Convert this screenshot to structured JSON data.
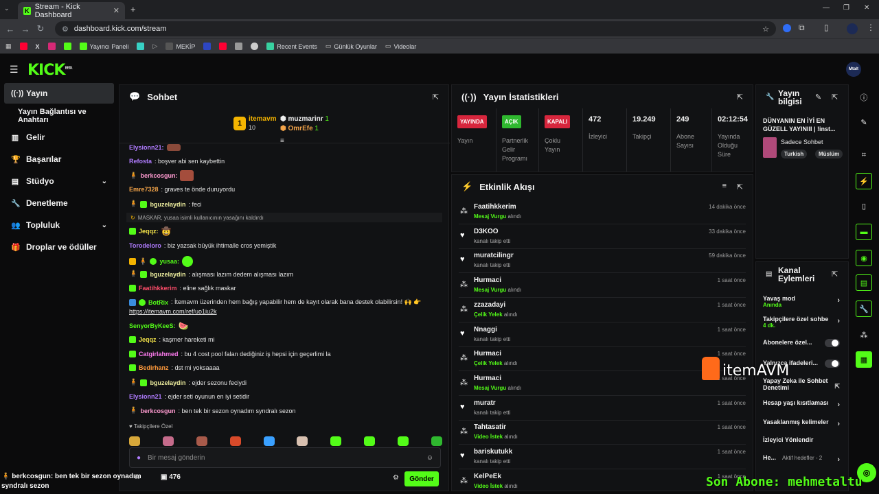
{
  "browser": {
    "tab_title": "Stream - Kick Dashboard",
    "url": "dashboard.kick.com/stream",
    "bookmarks": [
      "Yayıncı Paneli",
      "MEKİP",
      "Recent Events",
      "Günlük Oyunlar",
      "Videolar"
    ]
  },
  "kick": {
    "logo": "KICK",
    "logo_sup": "BETA",
    "avatar_text": "Mtalt"
  },
  "leftnav": {
    "items": [
      "Yayın",
      "Yayın Bağlantısı ve Anahtarı",
      "Gelir",
      "Başarılar",
      "Stüdyo",
      "Denetleme",
      "Topluluk",
      "Droplar ve ödüller"
    ]
  },
  "chat": {
    "title": "Sohbet",
    "leaders": [
      {
        "name": "itemavm",
        "count": "10",
        "rank": "1"
      },
      {
        "name": "muzmarinr",
        "count": "1"
      },
      {
        "name": "OmrEfe",
        "count": "1"
      }
    ],
    "messages": [
      {
        "user": "Elysionn21:",
        "text": "",
        "color": "#b07cff"
      },
      {
        "user": "Refosta",
        "text": ": boşver abi sen kaybettin",
        "color": "#b07cff"
      },
      {
        "user": "berkcosgun:",
        "text": "",
        "color": "#ff9bd1"
      },
      {
        "user": "Emre7328",
        "text": ": graves te önde duruyordu",
        "color": "#f2a349"
      },
      {
        "user": "bguzelaydin",
        "text": ": feci",
        "color": "#f0f0a0"
      },
      {
        "user": "Jeqqz:",
        "text": "",
        "color": "#f6e64a"
      },
      {
        "user": "Torodeloro",
        "text": ": biz yazsak büyük ihtimalle cros yemiştik",
        "color": "#b07cff"
      },
      {
        "user": "yusaa:",
        "text": "",
        "color": "#53fc18"
      },
      {
        "user": "bguzelaydin",
        "text": ": alışması lazım dedem alışması lazım",
        "color": "#f0f0a0"
      },
      {
        "user": "Faatihkkerim",
        "text": ": eline sağlık maskar",
        "color": "#ff4d6a"
      },
      {
        "user": "BotRix",
        "text": ": İtemavm üzerinden hem bağış yapabilir hem de kayıt olarak bana destek olabilirsin! 🙌 👉",
        "color": "#53fc18"
      },
      {
        "user": "",
        "text": "https://itemavm.com/ref/uo1iu2k",
        "color": "#ffffff"
      },
      {
        "user": "SenyorByKeeS:",
        "text": "",
        "color": "#53fc18"
      },
      {
        "user": "Jeqqz",
        "text": ": kaşmer hareketi mi",
        "color": "#f6e64a"
      },
      {
        "user": "Catgirlahmed",
        "text": ": bu 4 cost pool falan dediğiniz iş hepsi için geçerlimi la",
        "color": "#ff7cf0"
      },
      {
        "user": "Bedirhanz",
        "text": ": dst mi yoksaaaa",
        "color": "#ff9a3c"
      },
      {
        "user": "bguzelaydin",
        "text": ": ejder sezonu feciydi",
        "color": "#f0f0a0"
      },
      {
        "user": "Elysionn21",
        "text": ": ejder seti oyunun en iyi setidir",
        "color": "#b07cff"
      },
      {
        "user": "berkcosgun",
        "text": ": ben tek bir sezon oynadım syndralı sezon",
        "color": "#ff9bd1"
      }
    ],
    "system_note": "MASKAR, yusaa isimli kullanıcının yasağını kaldırdı",
    "followers_only": "Takipçilere Özel",
    "input_placeholder": "Bir mesaj gönderin",
    "viewer_count": "476",
    "send_label": "Gönder"
  },
  "stats": {
    "title": "Yayın İstatistikleri",
    "cols": [
      {
        "pill": "YAYINDA",
        "label": "Yayın",
        "color": "#d7263d"
      },
      {
        "pill": "AÇIK",
        "label": "Partnerlik Gelir Programı",
        "color": "#2fb82f"
      },
      {
        "pill": "KAPALI",
        "label": "Çoklu Yayın",
        "color": "#d7263d"
      },
      {
        "value": "472",
        "label": "İzleyici"
      },
      {
        "value": "19.249",
        "label": "Takipçi"
      },
      {
        "value": "249",
        "label": "Abone Sayısı"
      },
      {
        "value": "02:12:54",
        "label": "Yayında Olduğu Süre"
      }
    ]
  },
  "activity": {
    "title": "Etkinlik Akışı",
    "items": [
      {
        "name": "Faatihkkerim",
        "hl": "Mesaj Vurgu",
        "rest": " alındı",
        "time": "14 dakika önce",
        "icon": "gift"
      },
      {
        "name": "D3KOO",
        "hl": "",
        "rest": "kanalı takip etti",
        "time": "33 dakika önce",
        "icon": "heart"
      },
      {
        "name": "muratcilingr",
        "hl": "",
        "rest": "kanalı takip etti",
        "time": "59 dakika önce",
        "icon": "heart"
      },
      {
        "name": "Hurmaci",
        "hl": "Mesaj Vurgu",
        "rest": " alındı",
        "time": "1 saat önce",
        "icon": "gift"
      },
      {
        "name": "zzazadayi",
        "hl": "Çelik Yelek",
        "rest": " alındı",
        "time": "1 saat önce",
        "icon": "gift"
      },
      {
        "name": "Nnaggi",
        "hl": "",
        "rest": "kanalı takip etti",
        "time": "1 saat önce",
        "icon": "heart"
      },
      {
        "name": "Hurmaci",
        "hl": "Çelik Yelek",
        "rest": " alındı",
        "time": "1 saat önce",
        "icon": "gift"
      },
      {
        "name": "Hurmaci",
        "hl": "Mesaj Vurgu",
        "rest": " alındı",
        "time": "1 saat önce",
        "icon": "gift"
      },
      {
        "name": "muratr",
        "hl": "",
        "rest": "kanalı takip etti",
        "time": "1 saat önce",
        "icon": "heart"
      },
      {
        "name": "Tahtasatir",
        "hl": "Video İstek",
        "rest": " alındı",
        "time": "1 saat önce",
        "icon": "gift"
      },
      {
        "name": "bariskutukk",
        "hl": "",
        "rest": "kanalı takip etti",
        "time": "1 saat önce",
        "icon": "heart"
      },
      {
        "name": "KelPeEk",
        "hl": "Video İstek",
        "rest": " alındı",
        "time": "1 saat önce",
        "icon": "gift"
      }
    ]
  },
  "streaminfo": {
    "title": "Yayın bilgisi",
    "stream_title": "DÜNYANIN EN İYİ EN GÜZELL YAYINIII | !inst...",
    "category": "Sadece Sohbet",
    "tags": [
      "Turkish",
      "Müslüm"
    ]
  },
  "channel": {
    "title": "Kanal Eylemleri",
    "rows": [
      {
        "label": "Yavaş mod",
        "sub": "Anında",
        "kind": "arrow"
      },
      {
        "label": "Takipçilere özel sohbe",
        "sub": "4 dk.",
        "kind": "arrow"
      },
      {
        "label": "Abonelere özel...",
        "sub": "",
        "kind": "toggle"
      },
      {
        "label": "Yalnızca ifadeleri...",
        "sub": "",
        "kind": "toggle"
      },
      {
        "label": "Yapay Zeka ile Sohbet Denetimi",
        "sub": "",
        "kind": "ext"
      },
      {
        "label": "Hesap yaşı kısıtlaması",
        "sub": "",
        "kind": "arrow"
      },
      {
        "label": "Yasaklanmış kelimeler",
        "sub": "",
        "kind": "arrow"
      },
      {
        "label": "İzleyici Yönlendir",
        "sub": "",
        "kind": "none"
      },
      {
        "label": "He...",
        "sub": "Aktif hedefler - 2",
        "kind": "arrow"
      }
    ]
  },
  "overlay": {
    "watermark": "itemAVM",
    "ticker_user": "berkcosgun",
    "ticker_text": ": ben tek bir sezon oynadım syndralı sezon",
    "last_sub": "Son Abone: mehmetaltu"
  },
  "colors": {
    "accent": "#53fc18",
    "live": "#d7263d"
  }
}
